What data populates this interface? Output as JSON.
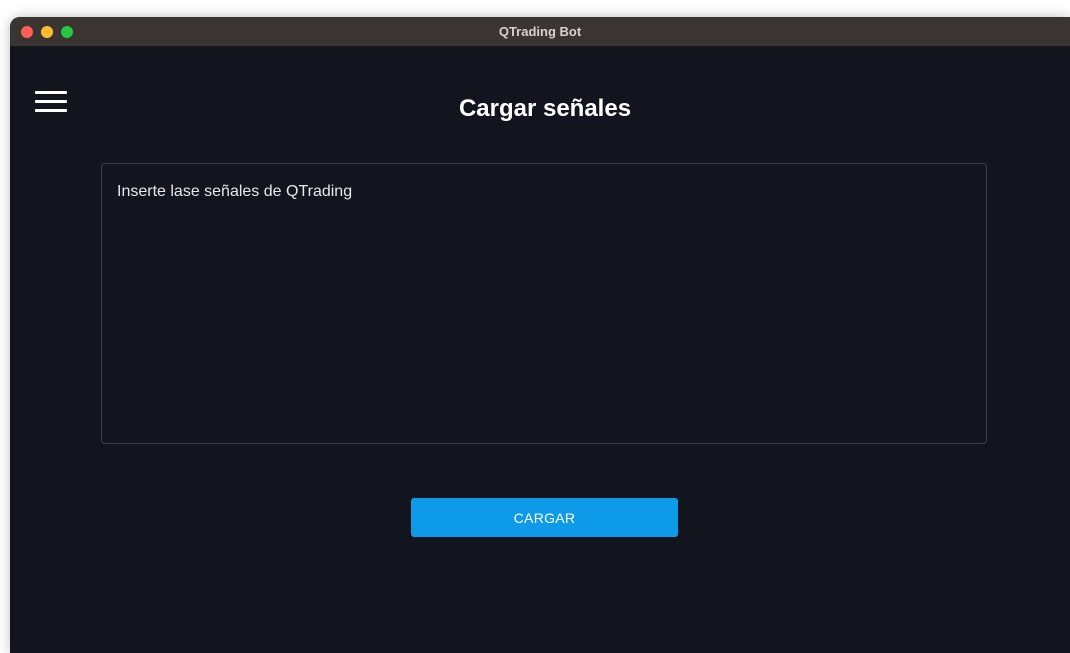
{
  "window": {
    "title": "QTrading Bot"
  },
  "header": {
    "menu_icon": "hamburger-menu-icon",
    "title": "Cargar señales"
  },
  "form": {
    "signals_placeholder": "Inserte lase señales de QTrading",
    "signals_value": "",
    "submit_label": "CARGAR"
  },
  "colors": {
    "background": "#12141e",
    "titlebar": "#3a3432",
    "accent": "#0d9ae8",
    "text": "#ffffff"
  }
}
